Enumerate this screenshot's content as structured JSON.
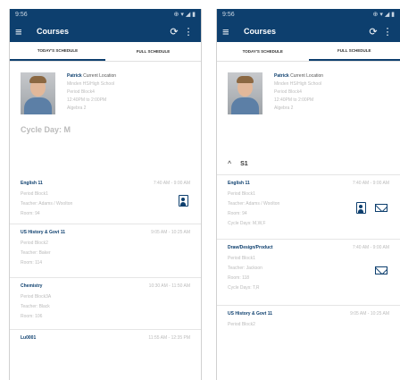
{
  "status": {
    "time": "9:56",
    "right": "⊕ ▾ ◢ ▮"
  },
  "app": {
    "title": "Courses",
    "menu_icon": "≡",
    "refresh_icon": "⟳",
    "more_icon": "⋮"
  },
  "tabs": [
    "TODAY'S SCHEDULE",
    "FULL SCHEDULE"
  ],
  "profile": {
    "name": "Patrick",
    "location": "Current Location",
    "school": "Minden HS/High School",
    "period": "Period Block4",
    "time": "12:40PM to 2:00PM",
    "course": "Algebra 2"
  },
  "left": {
    "cycle_day": "Cycle Day: M",
    "courses": [
      {
        "title": "English 11",
        "time": "7:40 AM - 9:00 AM",
        "lines": [
          "Period Block1",
          "Teacher: Adams / Woolton",
          "Room: 94"
        ],
        "has_contact": true
      },
      {
        "title": "US History & Govt 11",
        "time": "9:05 AM - 10:25 AM",
        "lines": [
          "Period Block2",
          "Teacher: Baker",
          "Room: 114"
        ]
      },
      {
        "title": "Chemistry",
        "time": "10:30 AM - 11:50 AM",
        "lines": [
          "Period Block3A",
          "Teacher: Black",
          "Room: 106"
        ]
      },
      {
        "title": "Lu0001",
        "time": "11:55 AM - 12:35 PM",
        "lines": []
      }
    ]
  },
  "right": {
    "section": "S1",
    "chevron": "^",
    "courses": [
      {
        "title": "English 11",
        "time": "7:40 AM - 9:00 AM",
        "lines": [
          "Period Block1",
          "Teacher: Adams / Woolton",
          "Room: 94",
          "Cycle Days: M,W,F"
        ]
      },
      {
        "title": "Draw/Design/Product",
        "time": "7:40 AM - 9:00 AM",
        "lines": [
          "Period Block1",
          "Teacher: Jackson",
          "Room: 118",
          "Cycle Days: T,R"
        ]
      },
      {
        "title": "US History & Govt 11",
        "time": "9:05 AM - 10:25 AM",
        "lines": [
          "Period Block2"
        ]
      }
    ]
  }
}
